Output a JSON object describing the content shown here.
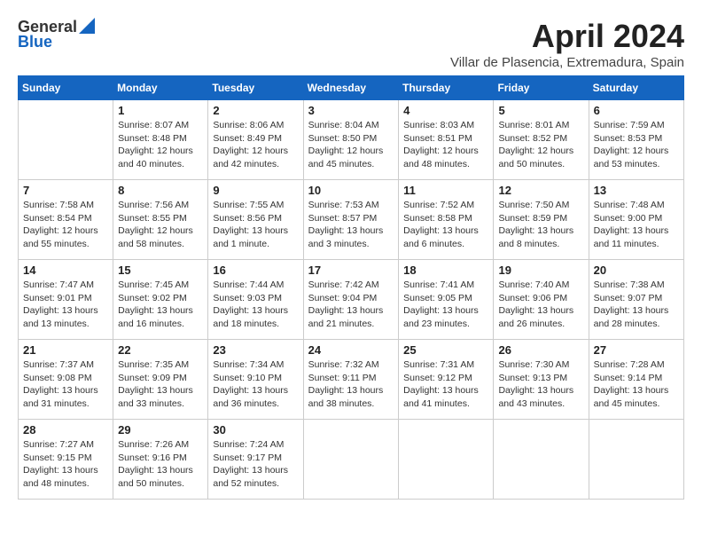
{
  "header": {
    "logo_general": "General",
    "logo_blue": "Blue",
    "month_title": "April 2024",
    "subtitle": "Villar de Plasencia, Extremadura, Spain"
  },
  "weekdays": [
    "Sunday",
    "Monday",
    "Tuesday",
    "Wednesday",
    "Thursday",
    "Friday",
    "Saturday"
  ],
  "weeks": [
    [
      {
        "day": "",
        "info": ""
      },
      {
        "day": "1",
        "info": "Sunrise: 8:07 AM\nSunset: 8:48 PM\nDaylight: 12 hours\nand 40 minutes."
      },
      {
        "day": "2",
        "info": "Sunrise: 8:06 AM\nSunset: 8:49 PM\nDaylight: 12 hours\nand 42 minutes."
      },
      {
        "day": "3",
        "info": "Sunrise: 8:04 AM\nSunset: 8:50 PM\nDaylight: 12 hours\nand 45 minutes."
      },
      {
        "day": "4",
        "info": "Sunrise: 8:03 AM\nSunset: 8:51 PM\nDaylight: 12 hours\nand 48 minutes."
      },
      {
        "day": "5",
        "info": "Sunrise: 8:01 AM\nSunset: 8:52 PM\nDaylight: 12 hours\nand 50 minutes."
      },
      {
        "day": "6",
        "info": "Sunrise: 7:59 AM\nSunset: 8:53 PM\nDaylight: 12 hours\nand 53 minutes."
      }
    ],
    [
      {
        "day": "7",
        "info": "Sunrise: 7:58 AM\nSunset: 8:54 PM\nDaylight: 12 hours\nand 55 minutes."
      },
      {
        "day": "8",
        "info": "Sunrise: 7:56 AM\nSunset: 8:55 PM\nDaylight: 12 hours\nand 58 minutes."
      },
      {
        "day": "9",
        "info": "Sunrise: 7:55 AM\nSunset: 8:56 PM\nDaylight: 13 hours\nand 1 minute."
      },
      {
        "day": "10",
        "info": "Sunrise: 7:53 AM\nSunset: 8:57 PM\nDaylight: 13 hours\nand 3 minutes."
      },
      {
        "day": "11",
        "info": "Sunrise: 7:52 AM\nSunset: 8:58 PM\nDaylight: 13 hours\nand 6 minutes."
      },
      {
        "day": "12",
        "info": "Sunrise: 7:50 AM\nSunset: 8:59 PM\nDaylight: 13 hours\nand 8 minutes."
      },
      {
        "day": "13",
        "info": "Sunrise: 7:48 AM\nSunset: 9:00 PM\nDaylight: 13 hours\nand 11 minutes."
      }
    ],
    [
      {
        "day": "14",
        "info": "Sunrise: 7:47 AM\nSunset: 9:01 PM\nDaylight: 13 hours\nand 13 minutes."
      },
      {
        "day": "15",
        "info": "Sunrise: 7:45 AM\nSunset: 9:02 PM\nDaylight: 13 hours\nand 16 minutes."
      },
      {
        "day": "16",
        "info": "Sunrise: 7:44 AM\nSunset: 9:03 PM\nDaylight: 13 hours\nand 18 minutes."
      },
      {
        "day": "17",
        "info": "Sunrise: 7:42 AM\nSunset: 9:04 PM\nDaylight: 13 hours\nand 21 minutes."
      },
      {
        "day": "18",
        "info": "Sunrise: 7:41 AM\nSunset: 9:05 PM\nDaylight: 13 hours\nand 23 minutes."
      },
      {
        "day": "19",
        "info": "Sunrise: 7:40 AM\nSunset: 9:06 PM\nDaylight: 13 hours\nand 26 minutes."
      },
      {
        "day": "20",
        "info": "Sunrise: 7:38 AM\nSunset: 9:07 PM\nDaylight: 13 hours\nand 28 minutes."
      }
    ],
    [
      {
        "day": "21",
        "info": "Sunrise: 7:37 AM\nSunset: 9:08 PM\nDaylight: 13 hours\nand 31 minutes."
      },
      {
        "day": "22",
        "info": "Sunrise: 7:35 AM\nSunset: 9:09 PM\nDaylight: 13 hours\nand 33 minutes."
      },
      {
        "day": "23",
        "info": "Sunrise: 7:34 AM\nSunset: 9:10 PM\nDaylight: 13 hours\nand 36 minutes."
      },
      {
        "day": "24",
        "info": "Sunrise: 7:32 AM\nSunset: 9:11 PM\nDaylight: 13 hours\nand 38 minutes."
      },
      {
        "day": "25",
        "info": "Sunrise: 7:31 AM\nSunset: 9:12 PM\nDaylight: 13 hours\nand 41 minutes."
      },
      {
        "day": "26",
        "info": "Sunrise: 7:30 AM\nSunset: 9:13 PM\nDaylight: 13 hours\nand 43 minutes."
      },
      {
        "day": "27",
        "info": "Sunrise: 7:28 AM\nSunset: 9:14 PM\nDaylight: 13 hours\nand 45 minutes."
      }
    ],
    [
      {
        "day": "28",
        "info": "Sunrise: 7:27 AM\nSunset: 9:15 PM\nDaylight: 13 hours\nand 48 minutes."
      },
      {
        "day": "29",
        "info": "Sunrise: 7:26 AM\nSunset: 9:16 PM\nDaylight: 13 hours\nand 50 minutes."
      },
      {
        "day": "30",
        "info": "Sunrise: 7:24 AM\nSunset: 9:17 PM\nDaylight: 13 hours\nand 52 minutes."
      },
      {
        "day": "",
        "info": ""
      },
      {
        "day": "",
        "info": ""
      },
      {
        "day": "",
        "info": ""
      },
      {
        "day": "",
        "info": ""
      }
    ]
  ]
}
